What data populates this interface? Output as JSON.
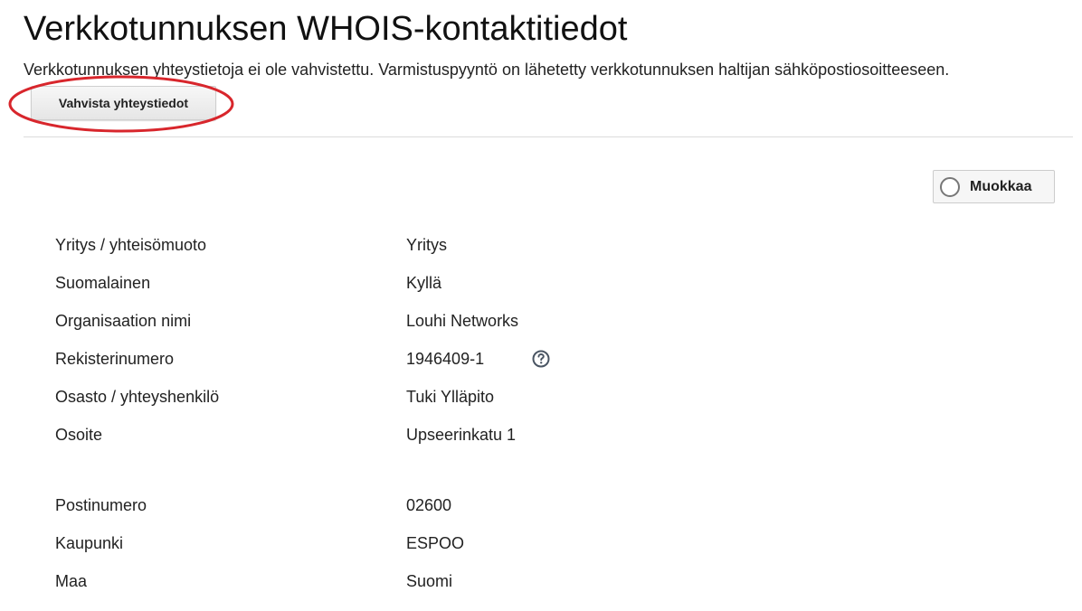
{
  "header": {
    "title": "Verkkotunnuksen WHOIS-kontaktitiedot",
    "notice": "Verkkotunnuksen yhteystietoja ei ole vahvistettu. Varmistuspyyntö on lähetetty verkkotunnuksen haltijan sähköpostiosoitteeseen.",
    "verify_button_label": "Vahvista yhteystiedot"
  },
  "toolbar": {
    "edit_button_label": "Muokkaa",
    "edit_toggle_icon": "circle-toggle-icon"
  },
  "contact": {
    "rows": [
      {
        "label": "Yritys / yhteisömuoto",
        "value": "Yritys"
      },
      {
        "label": "Suomalainen",
        "value": "Kyllä"
      },
      {
        "label": "Organisaation nimi",
        "value": "Louhi Networks"
      },
      {
        "label": "Rekisterinumero",
        "value": "1946409-1",
        "help_icon": "question-circle-icon"
      },
      {
        "label": "Osasto / yhteyshenkilö",
        "value": "Tuki Ylläpito"
      },
      {
        "label": "Osoite",
        "value": "Upseerinkatu 1"
      },
      {
        "label": "Postinumero",
        "value": "02600"
      },
      {
        "label": "Kaupunki",
        "value": "ESPOO"
      },
      {
        "label": "Maa",
        "value": "Suomi"
      }
    ]
  },
  "colors": {
    "annotation_ring": "#d8262c",
    "button_border": "#cfcfcf",
    "divider": "#dcdcdc"
  }
}
